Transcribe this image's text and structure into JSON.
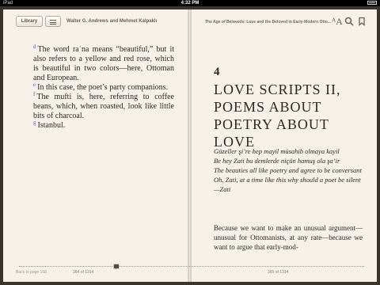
{
  "status": {
    "device": "iPad",
    "time": "4:32 PM",
    "battery_icon": "battery-icon"
  },
  "toolbar": {
    "library_label": "Library",
    "toc_icon": "list-icon",
    "author": "Walter G. Andrews and Mehmet Kalpaklı",
    "book_title": "The Age of Beloveds: Love and the Beloved in Early-Modern Otto...",
    "font_icon": "text-size-icon",
    "search_icon": "search-icon",
    "bookmark_icon": "bookmark-icon"
  },
  "left_page": {
    "notes": [
      {
        "marker": "d",
        "text": "The word raʿna means “beautiful,” but it also refers to a yellow and red rose, which is beautiful in two colors—here, Ottoman and European."
      },
      {
        "marker": "e",
        "text": "In this case, the poet’s party companions."
      },
      {
        "marker": "f",
        "text": "The mufti is, here, referring to coffee beans, which, when roasted, look like little bits of charcoal."
      },
      {
        "marker": "g",
        "text": "Istanbul."
      }
    ],
    "back_link": "Back to page 168",
    "page_number": "364 of 1314"
  },
  "right_page": {
    "chapter_number": "4",
    "chapter_title": "LOVE SCRIPTS II, POEMS ABOUT POETRY ABOUT LOVE",
    "poem_lines": [
      "Güzeller şi’re hep mayil müsahib olmaya kayil",
      "Be hey Zati bu demlerde niçün hamuş ola şa’ir",
      "The beauties all like poetry and agree to be conversant",
      "Oh, Zati, at a time like this why should a poet be silent",
      "—Zati"
    ],
    "prose": "Because we want to make an unusual argument—unusual for Ottomanists, at any rate—because we want to argue that early-mod-",
    "page_number": "365 of 1314"
  },
  "progress": {
    "position": 0.277
  },
  "colors": {
    "page": "#f6f2ea",
    "text": "#2d2925",
    "note_marker": "#6d5aa4",
    "frame": "#3a342d"
  }
}
